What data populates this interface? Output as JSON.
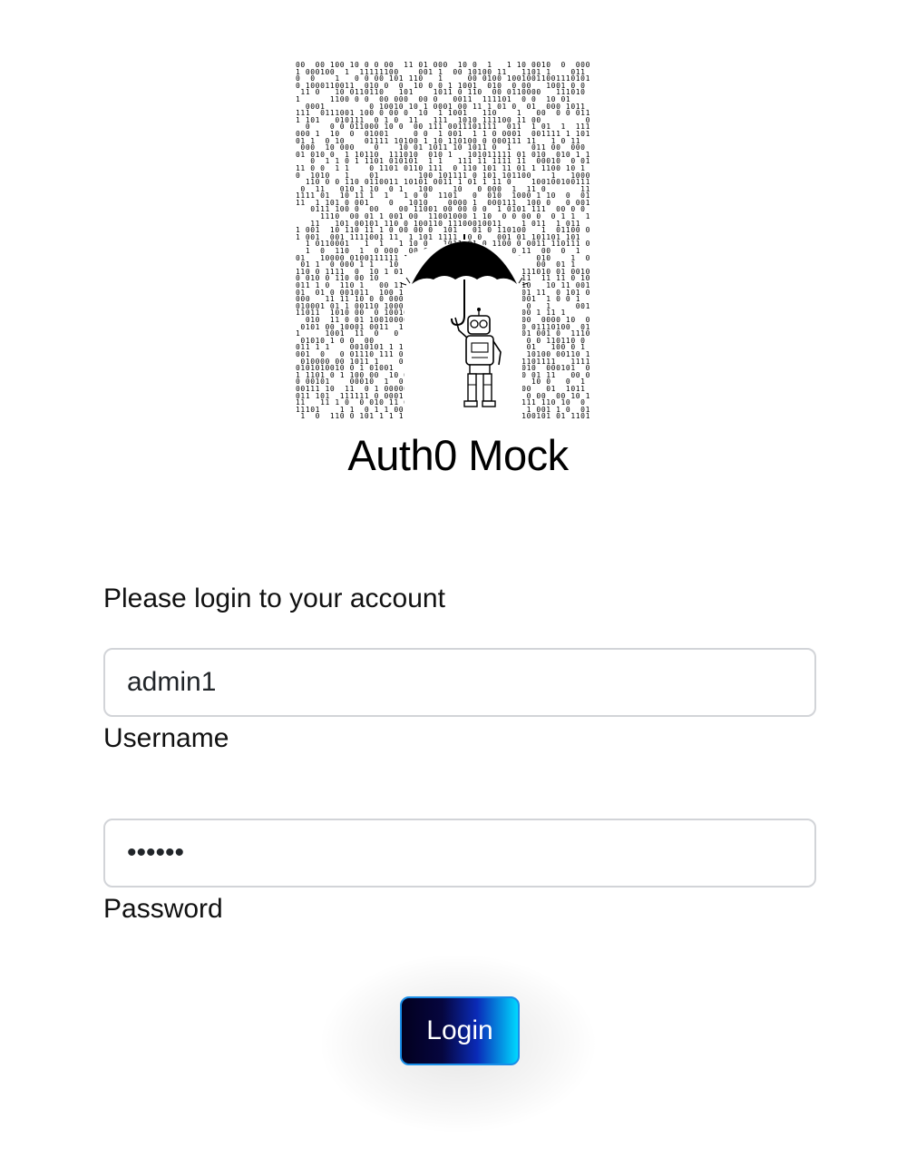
{
  "app": {
    "title": "Auth0 Mock"
  },
  "logo": {
    "description_icon": "robot-with-umbrella-in-binary-rain-icon"
  },
  "form": {
    "prompt": "Please login to your account",
    "username": {
      "value": "admin1",
      "label": "Username"
    },
    "password": {
      "value": "••••••",
      "label": "Password"
    },
    "submit_label": "Login"
  },
  "colors": {
    "button_gradient_start": "#02001f",
    "button_gradient_end": "#00d8ff",
    "button_border": "#1a8fe8",
    "input_border": "#d2d4d8"
  }
}
